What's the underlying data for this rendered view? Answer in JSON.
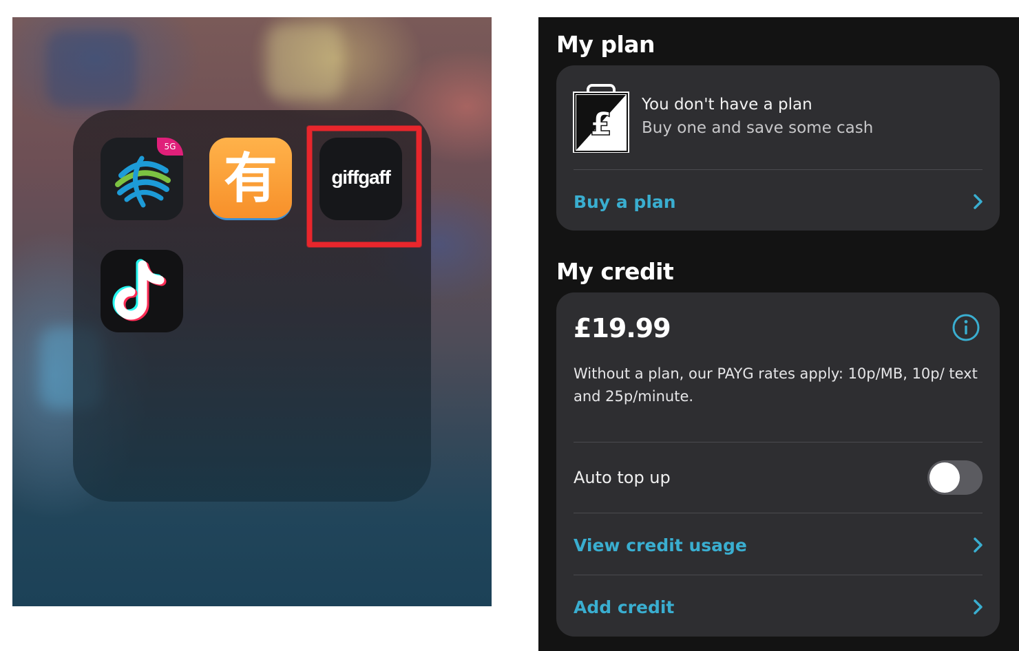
{
  "home_screen": {
    "folder_apps": [
      {
        "name": "china-mobile",
        "badge": "5G"
      },
      {
        "name": "youdao",
        "glyph": "有"
      },
      {
        "name": "giffgaff",
        "wordmark": "giffgaff"
      },
      {
        "name": "tiktok"
      }
    ],
    "highlight_color": "#e8262c"
  },
  "giffgaff_app": {
    "plan_section": {
      "title": "My plan",
      "empty_title": "You don't have a plan",
      "empty_subtitle": "Buy one and save some cash",
      "bag_symbol": "£",
      "buy_link": "Buy a plan"
    },
    "credit_section": {
      "title": "My credit",
      "balance": "£19.99",
      "rates_text": "Without a plan, our PAYG rates apply: 10p/MB, 10p/ text and 25p/minute.",
      "auto_top_up_label": "Auto top up",
      "auto_top_up_enabled": false,
      "view_usage_link": "View credit usage",
      "add_credit_link": "Add credit"
    },
    "colors": {
      "background": "#131313",
      "card": "#2e2e31",
      "link": "#3aaed0"
    }
  }
}
